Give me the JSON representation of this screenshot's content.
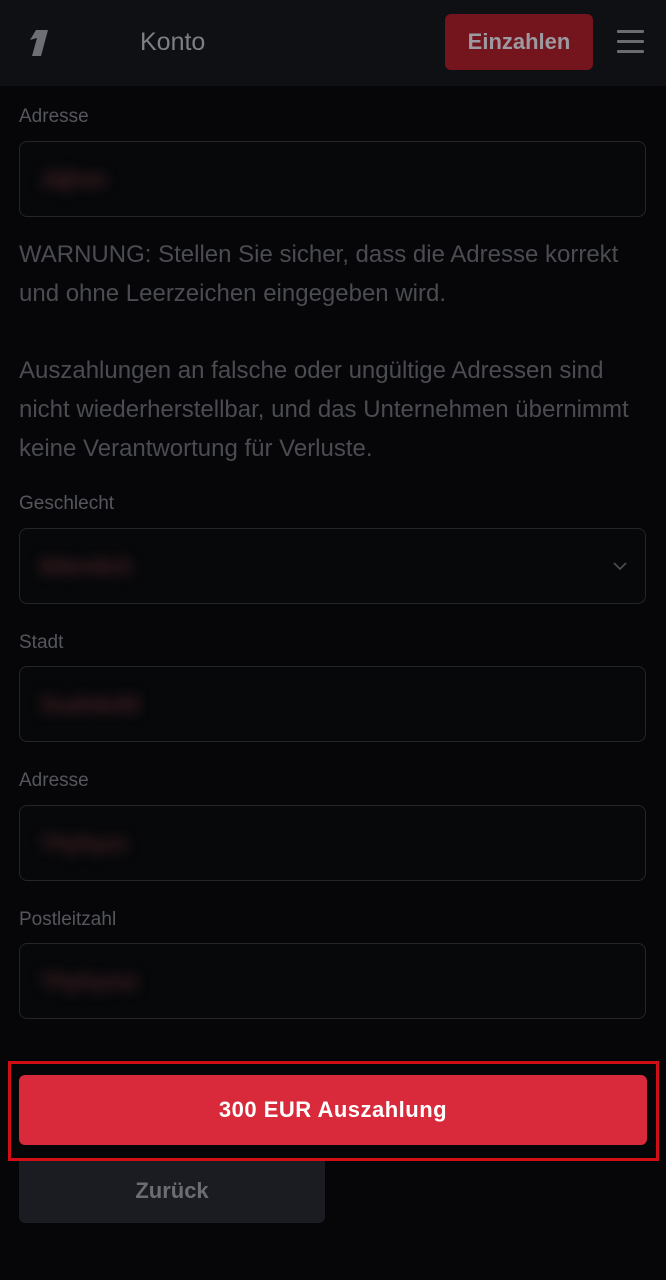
{
  "header": {
    "title": "Konto",
    "deposit_label": "Einzahlen",
    "logo_icon": "logo-1-icon",
    "menu_icon": "hamburger-menu-icon"
  },
  "form": {
    "address1": {
      "label": "Adresse",
      "value": "Jäjhsn"
    },
    "warning_1": "WARNUNG: Stellen Sie sicher, dass die Adresse korrekt und ohne Leerzeichen eingegeben wird.",
    "warning_2": "Auszahlungen an falsche oder ungültige Adressen sind nicht wiederherstellbar, und das Unternehmen übernimmt keine Verantwortung für Verluste.",
    "gender": {
      "label": "Geschlecht",
      "value": "Männlich"
    },
    "city": {
      "label": "Stadt",
      "value": "Suahdufd"
    },
    "address2": {
      "label": "Adresse",
      "value": "Yhyhyzs"
    },
    "postal": {
      "label": "Postleitzahl",
      "value": "Yhyhyzsz"
    }
  },
  "actions": {
    "withdraw_label": "300 EUR Auszahlung",
    "back_label": "Zurück"
  },
  "colors": {
    "accent": "#d82a3b",
    "deposit_bg": "#74151e",
    "highlight": "#d10d16",
    "background": "#060608"
  }
}
